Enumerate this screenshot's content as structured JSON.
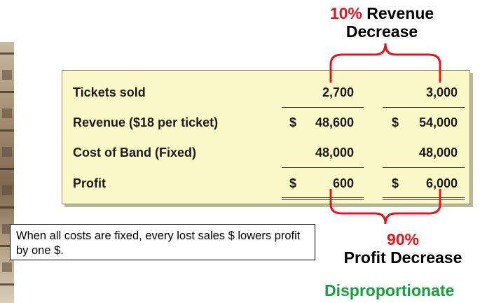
{
  "top_label": {
    "percent": "10%",
    "rest": "Revenue",
    "line2": "Decrease"
  },
  "table": {
    "rows": [
      {
        "label": "Tickets sold",
        "col1_dollar": "",
        "col1": "2,700",
        "col2_dollar": "",
        "col2": "3,000"
      },
      {
        "label": "Revenue ($18 per ticket)",
        "col1_dollar": "$",
        "col1": "48,600",
        "col2_dollar": "$",
        "col2": "54,000"
      },
      {
        "label": "Cost of Band (Fixed)",
        "col1_dollar": "",
        "col1": "48,000",
        "col2_dollar": "",
        "col2": "48,000"
      },
      {
        "label": "Profit",
        "col1_dollar": "$",
        "col1": "600",
        "col2_dollar": "$",
        "col2": "6,000"
      }
    ]
  },
  "note": "When all costs are fixed, every lost sales $ lowers profit by one $.",
  "bottom_label": {
    "percent": "90%",
    "line2": "Profit Decrease"
  },
  "disproportionate": "Disproportionate",
  "colors": {
    "accent_red": "#e8141b",
    "green": "#16a03c",
    "table_bg": "#fdf8c7"
  }
}
